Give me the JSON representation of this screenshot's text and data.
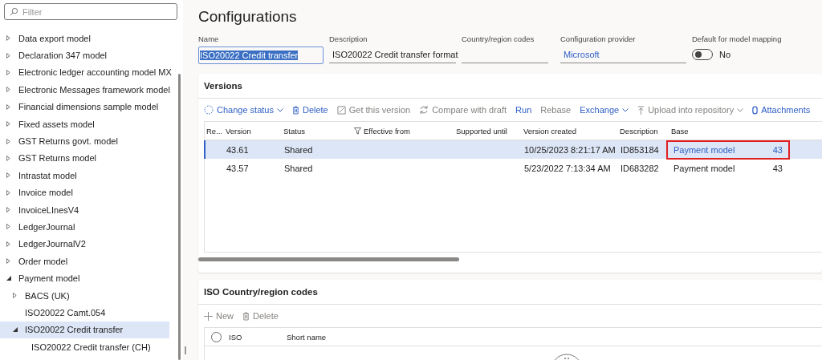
{
  "filter": {
    "placeholder": "Filter"
  },
  "tree": [
    {
      "label": "Data export model",
      "expanded": false,
      "selected": false
    },
    {
      "label": "Declaration 347 model",
      "expanded": false,
      "selected": false
    },
    {
      "label": "Electronic ledger accounting model MX",
      "expanded": false,
      "selected": false
    },
    {
      "label": "Electronic Messages framework model",
      "expanded": false,
      "selected": false
    },
    {
      "label": "Financial dimensions sample model",
      "expanded": false,
      "selected": false
    },
    {
      "label": "Fixed assets model",
      "expanded": false,
      "selected": false
    },
    {
      "label": "GST Returns govt. model",
      "expanded": false,
      "selected": false
    },
    {
      "label": "GST Returns model",
      "expanded": false,
      "selected": false
    },
    {
      "label": "Intrastat model",
      "expanded": false,
      "selected": false
    },
    {
      "label": "Invoice model",
      "expanded": false,
      "selected": false
    },
    {
      "label": "InvoiceLInesV4",
      "expanded": false,
      "selected": false
    },
    {
      "label": "LedgerJournal",
      "expanded": false,
      "selected": false
    },
    {
      "label": "LedgerJournalV2",
      "expanded": false,
      "selected": false
    },
    {
      "label": "Order model",
      "expanded": false,
      "selected": false
    },
    {
      "label": "Payment model",
      "expanded": true,
      "selected": false,
      "children": [
        {
          "label": "BACS (UK)",
          "expanded": false,
          "selected": false
        },
        {
          "label": "ISO20022 Camt.054",
          "selected": false
        },
        {
          "label": "ISO20022 Credit transfer",
          "expanded": true,
          "selected": true,
          "children": [
            {
              "label": "ISO20022 Credit transfer (CH)",
              "selected": false
            }
          ]
        }
      ]
    }
  ],
  "title": "Configurations",
  "fields": [
    {
      "label": "Name",
      "kind": "text",
      "value": "ISO20022 Credit transfer",
      "focused": true
    },
    {
      "label": "Description",
      "kind": "text",
      "value": "ISO20022 Credit transfer format",
      "focused": false
    },
    {
      "label": "Country/region codes",
      "kind": "text",
      "focused": false
    },
    {
      "label": "Configuration provider",
      "kind": "link",
      "value": "Microsoft",
      "focused": false
    },
    {
      "label": "Default for model mapping",
      "kind": "toggle",
      "on": false,
      "value": "No"
    }
  ],
  "versions": {
    "title": "Versions",
    "toolbar": [
      {
        "label": "Change status",
        "disabled": false,
        "menu": true
      },
      {
        "label": "Delete",
        "disabled": false,
        "menu": false
      },
      {
        "label": "Get this version",
        "disabled": true,
        "menu": false
      },
      {
        "label": "Compare with draft",
        "disabled": true,
        "menu": false
      },
      {
        "label": "Run",
        "disabled": false,
        "menu": false
      },
      {
        "label": "Rebase",
        "disabled": true,
        "menu": false
      },
      {
        "label": "Exchange",
        "disabled": false,
        "menu": true
      },
      {
        "label": "Upload into repository",
        "disabled": true,
        "menu": true
      },
      {
        "label": "Attachments",
        "disabled": false,
        "menu": false
      }
    ],
    "columns": [
      "Re...",
      "Version",
      "Status",
      "Effective from",
      "Supported until",
      "Version created",
      "Description",
      "Base"
    ],
    "rows": [
      {
        "version": "43.61",
        "status": "Shared",
        "created": "10/25/2023 8:21:17 AM",
        "description": "ID853184",
        "base": "Payment model",
        "base_version": "43",
        "selected": true,
        "highlighted": true
      },
      {
        "version": "43.57",
        "status": "Shared",
        "created": "5/23/2022 7:13:34 AM",
        "description": "ID683282",
        "base": "Payment model",
        "base_version": "43",
        "selected": false,
        "highlighted": false
      }
    ]
  },
  "iso": {
    "title": "ISO Country/region codes",
    "toolbar": [
      {
        "label": "New",
        "disabled": true
      },
      {
        "label": "Delete",
        "disabled": true
      }
    ],
    "all_selected": false,
    "columns": [
      "ISO",
      "Short name"
    ]
  }
}
